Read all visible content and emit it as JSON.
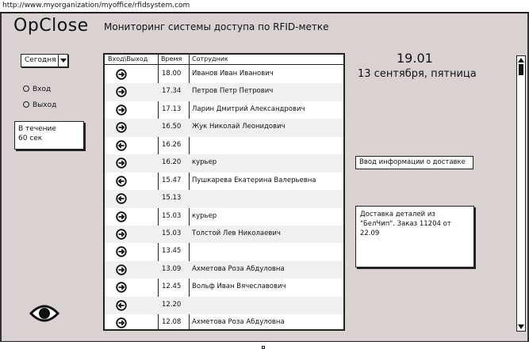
{
  "browser": {
    "url": "http://www.myorganization/myoffice/rfidsystem.com"
  },
  "header": {
    "brand": "OpClose",
    "subtitle": "Мониторинг системы доступа по RFID-метке"
  },
  "filters": {
    "period_selected": "Сегодня",
    "radio_in_label": "Вход",
    "radio_out_label": "Выход",
    "timer_line1": "В течение",
    "timer_line2": "60 сек"
  },
  "table": {
    "headers": {
      "direction": "Вход\\Выход",
      "time": "Время",
      "employee": "Сотрудник"
    },
    "rows": [
      {
        "direction": "in",
        "time": "18.00",
        "employee": "Иванов Иван Иванович"
      },
      {
        "direction": "in",
        "time": "17.34",
        "employee": "Петров Петр Петрович"
      },
      {
        "direction": "in",
        "time": "17.13",
        "employee": "Ларин Дмитрий Александрович"
      },
      {
        "direction": "in",
        "time": "16.50",
        "employee": "Жук Николай Леонидович"
      },
      {
        "direction": "out",
        "time": "16.26",
        "employee": ""
      },
      {
        "direction": "in",
        "time": "16.20",
        "employee": "курьер"
      },
      {
        "direction": "out",
        "time": "15.47",
        "employee": "Пушкарева Екатерина Валерьевна"
      },
      {
        "direction": "out",
        "time": "15.13",
        "employee": ""
      },
      {
        "direction": "in",
        "time": "15.03",
        "employee": "курьер"
      },
      {
        "direction": "in",
        "time": "15.03",
        "employee": "Толстой Лев Николаевич"
      },
      {
        "direction": "in",
        "time": "13.45",
        "employee": ""
      },
      {
        "direction": "in",
        "time": "13.09",
        "employee": "Ахметова Роза Абдуловна"
      },
      {
        "direction": "in",
        "time": "12.45",
        "employee": "Вольф Иван Вячеславович"
      },
      {
        "direction": "out",
        "time": "12.20",
        "employee": ""
      },
      {
        "direction": "in",
        "time": "12.08",
        "employee": "Ахметова Роза Абдуловна"
      }
    ]
  },
  "clock": {
    "time": "19.01",
    "date": "13 сентября, пятница"
  },
  "delivery": {
    "input_value": "Ввод информации о доставке",
    "note": "Доставка деталей из \"БелЧип\". Заказ 11204 от 22.09"
  },
  "icons": {
    "view": "eye-icon",
    "entry": "arrow-right-circle-icon",
    "exit": "arrow-left-circle-icon"
  }
}
